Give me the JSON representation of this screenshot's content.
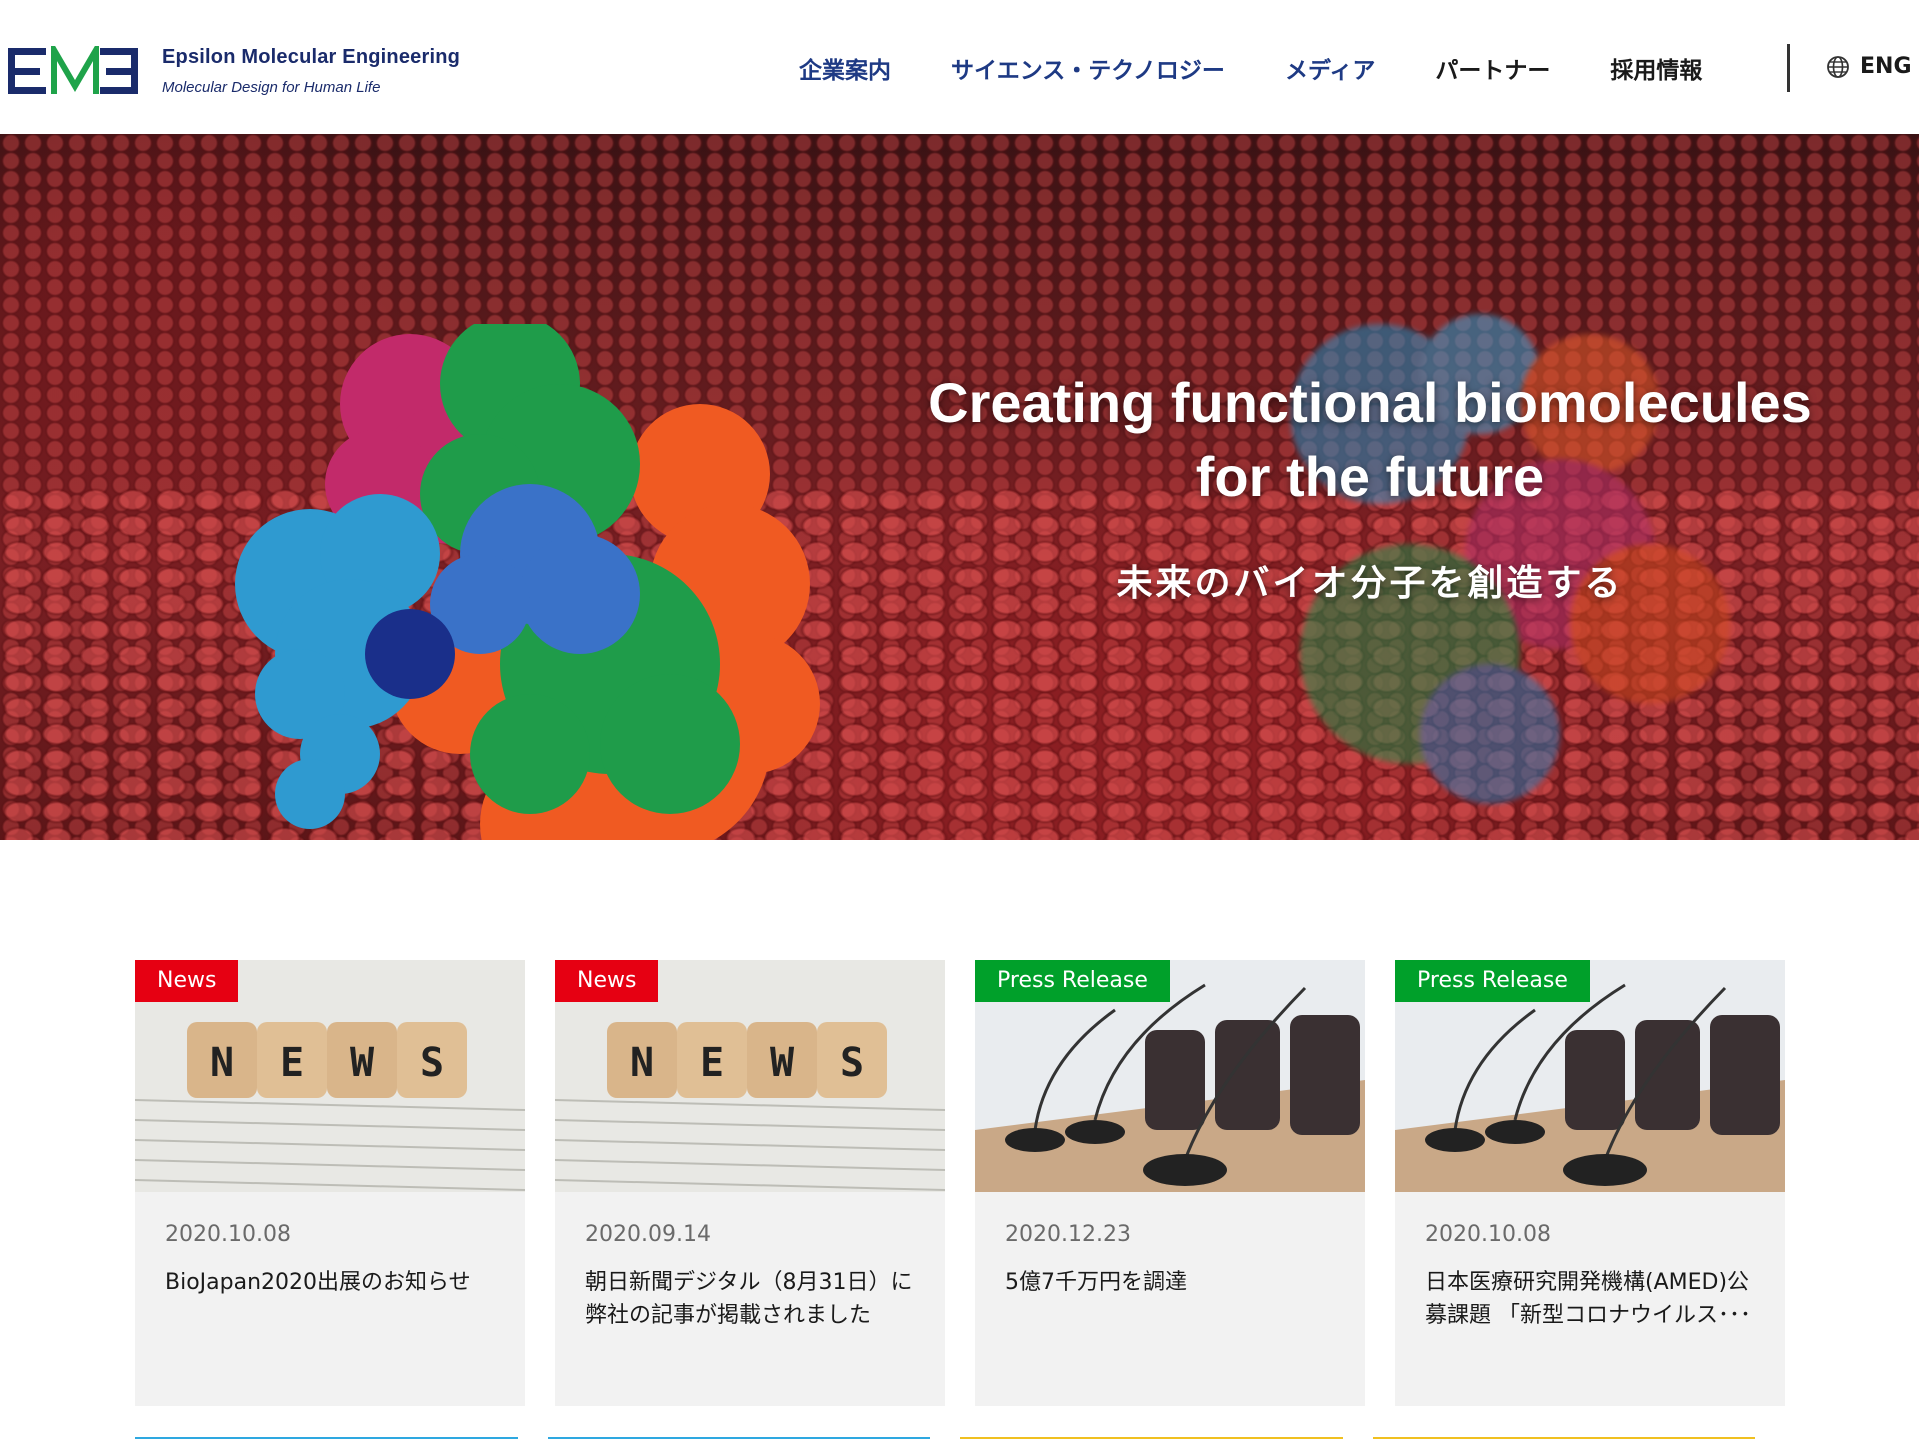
{
  "brand": {
    "name": "Epsilon Molecular Engineering",
    "tagline": "Molecular Design for Human Life",
    "navy": "#1a2b6b"
  },
  "nav": {
    "items": [
      {
        "label": "企業案内"
      },
      {
        "label": "サイエンス・テクノロジー"
      },
      {
        "label": "メディア"
      },
      {
        "label": "パートナー"
      },
      {
        "label": "採用情報"
      }
    ],
    "language": {
      "icon": "globe-icon",
      "label": "ENG"
    }
  },
  "hero": {
    "title_line1": "Creating functional biomolecules",
    "title_line2": "for the future",
    "subtitle": "未来のバイオ分子を創造する"
  },
  "cards": [
    {
      "tag": "News",
      "tag_color": "#e60012",
      "thumb": "news-dice",
      "date": "2020.10.08",
      "title": "BioJapan2020出展のお知らせ"
    },
    {
      "tag": "News",
      "tag_color": "#e60012",
      "thumb": "news-dice",
      "date": "2020.09.14",
      "title": "朝日新聞デジタル（8月31日）に弊社の記事が掲載されました"
    },
    {
      "tag": "Press Release",
      "tag_color": "#00a02a",
      "thumb": "press-microphones",
      "date": "2020.12.23",
      "title": "5億7千万円を調達"
    },
    {
      "tag": "Press Release",
      "tag_color": "#00a02a",
      "thumb": "press-microphones",
      "date": "2020.10.08",
      "title": "日本医療研究開発機構(AMED)公募課題 「新型コロナウイルス･･･"
    }
  ],
  "dice_letters": [
    "N",
    "E",
    "W",
    "S"
  ]
}
